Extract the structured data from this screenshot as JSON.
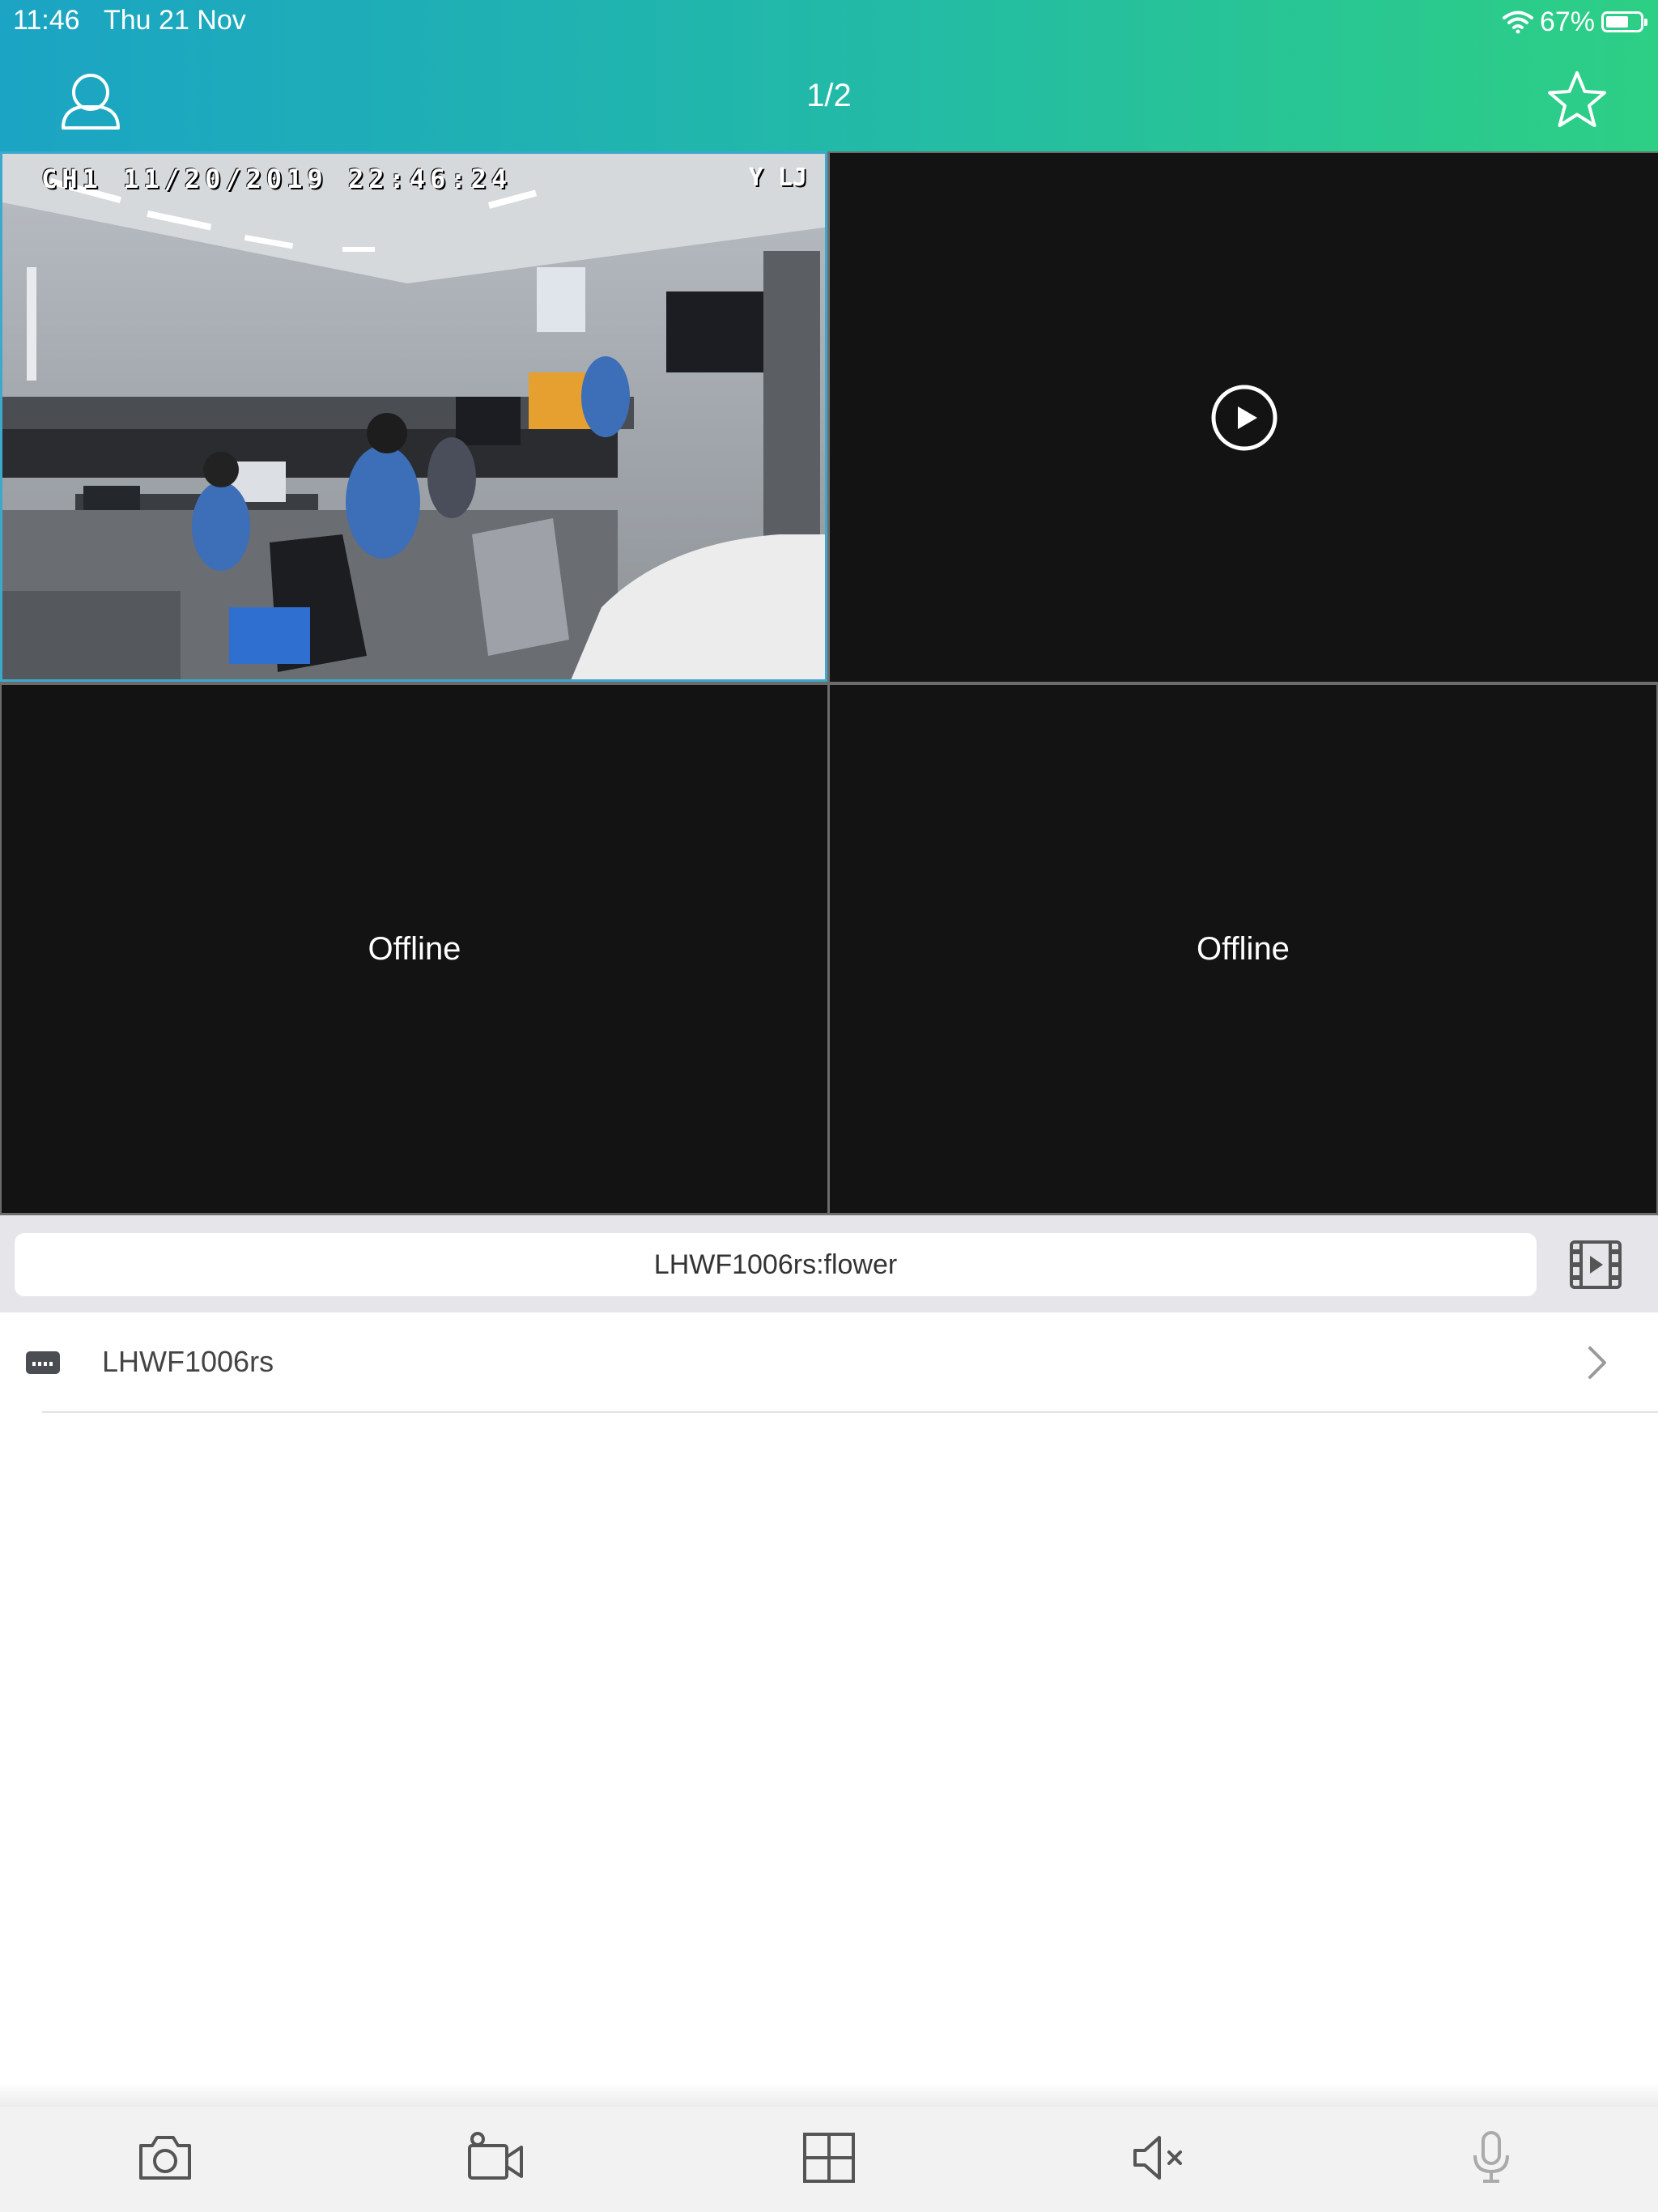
{
  "status_bar": {
    "time": "11:46",
    "date": "Thu 21 Nov",
    "battery": "67%",
    "battery_level": 0.67
  },
  "header": {
    "page_indicator": "1/2",
    "left_icon": "user-icon",
    "right_icon": "star-icon"
  },
  "video_grid": {
    "cells": [
      {
        "state": "live",
        "osd_text": "CH1 11/20/2019 22:46:24",
        "osd_right": "Y  LJ"
      },
      {
        "state": "paused",
        "icon": "play-circle-icon"
      },
      {
        "state": "offline",
        "label": "Offline"
      },
      {
        "state": "offline",
        "label": "Offline"
      }
    ]
  },
  "name_bar": {
    "value": "LHWF1006rs:flower",
    "icon": "film-icon"
  },
  "device_list": {
    "items": [
      {
        "label": "LHWF1006rs",
        "icon": "device-icon"
      }
    ]
  },
  "toolbar": {
    "buttons": [
      {
        "icon": "camera-icon"
      },
      {
        "icon": "video-record-icon"
      },
      {
        "icon": "grid-layout-icon"
      },
      {
        "icon": "speaker-muted-icon"
      },
      {
        "icon": "microphone-icon"
      }
    ]
  },
  "colors": {
    "header_gradient_start": "#1ba4c4",
    "header_gradient_end": "#2dcf85",
    "selected_border": "#3ea8cc",
    "cell_background": "#131313"
  }
}
